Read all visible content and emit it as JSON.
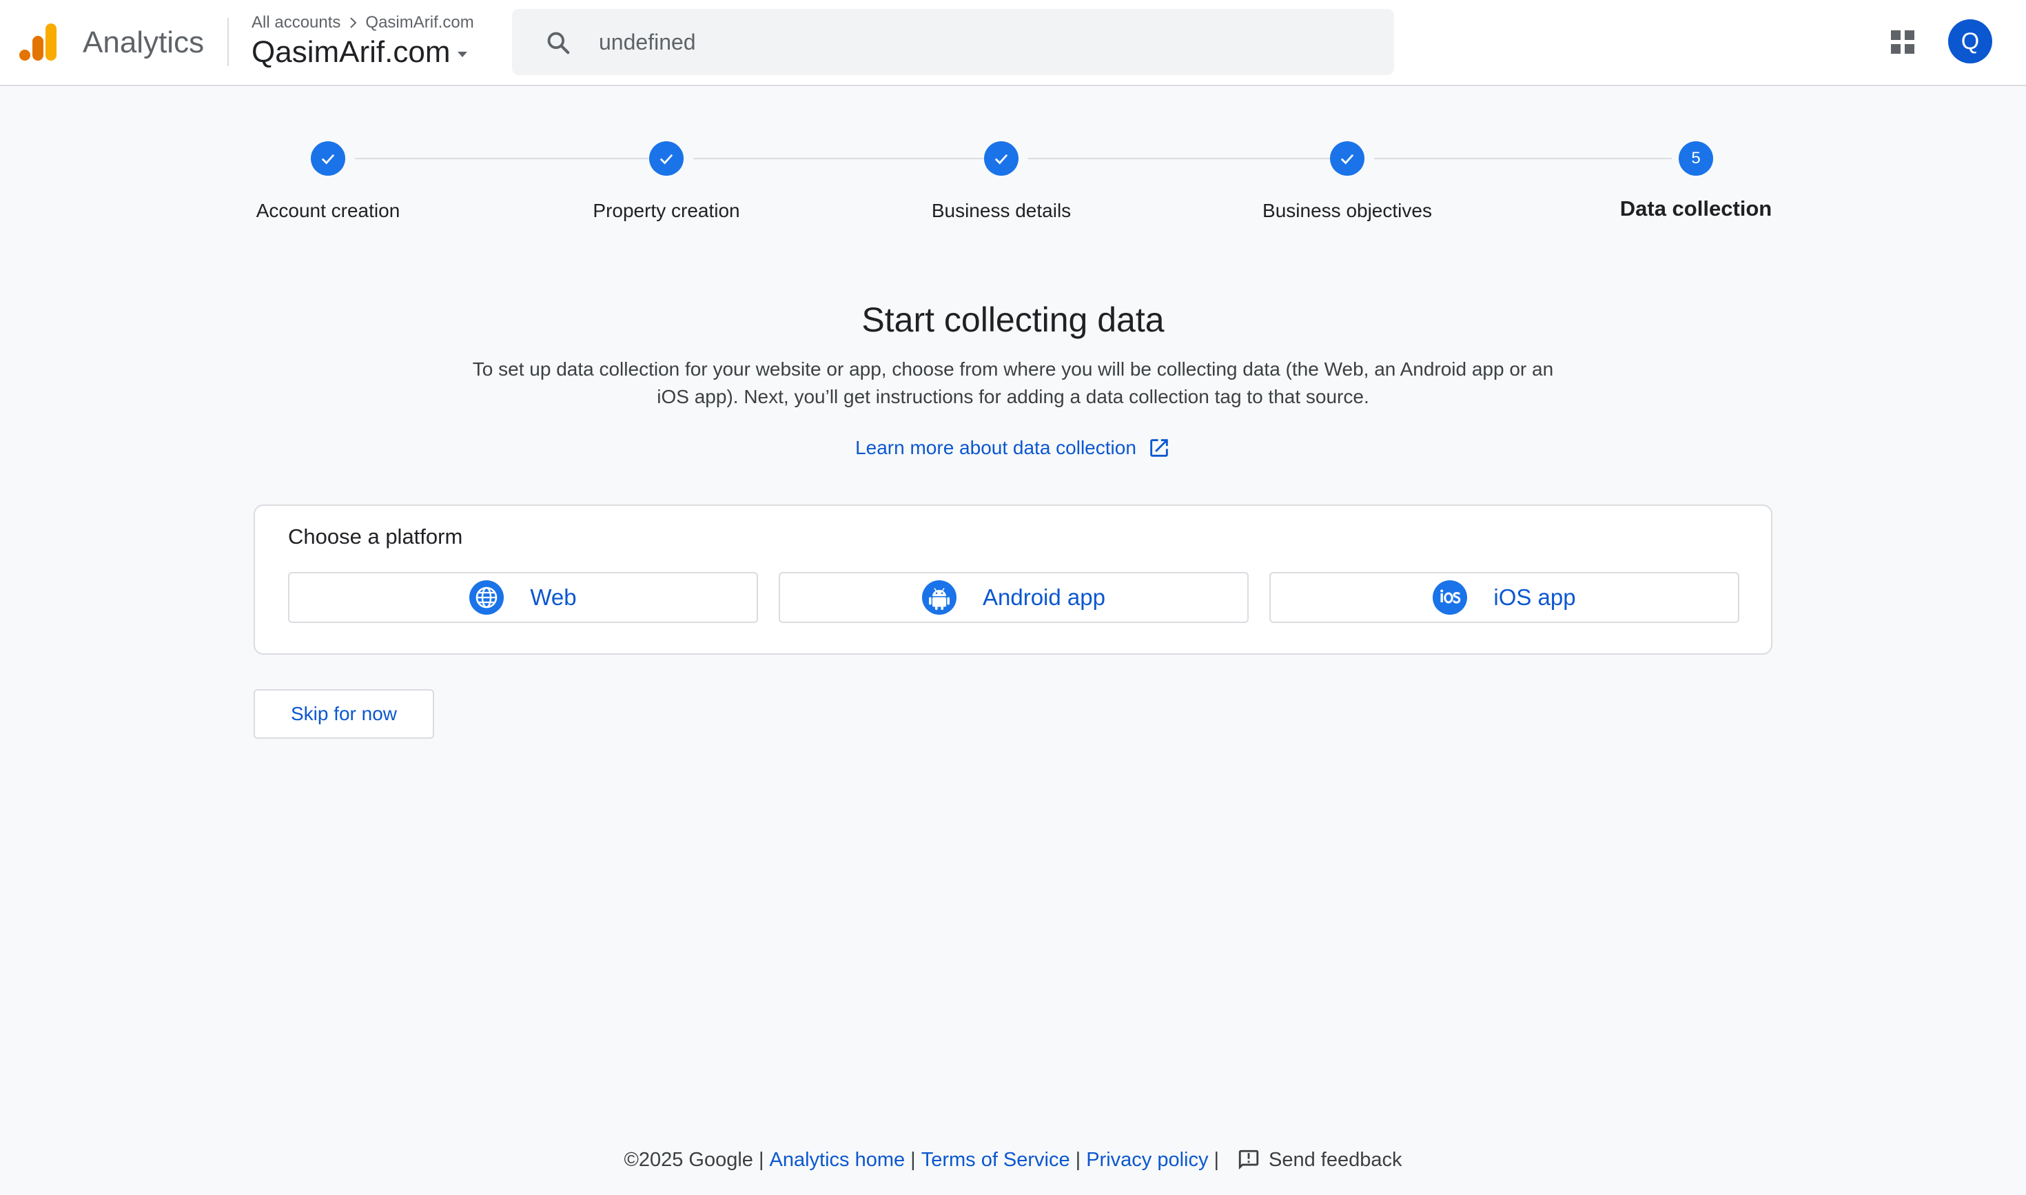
{
  "app": {
    "product_name": "Analytics",
    "brand_colors": {
      "logo_dark": "#e37400",
      "logo_light": "#f9ab00",
      "primary": "#1a73e8",
      "link": "#0b57d0"
    }
  },
  "header": {
    "breadcrumb": {
      "root": "All accounts",
      "current": "QasimArif.com"
    },
    "account_name": "QasimArif.com",
    "search": {
      "value": "undefined",
      "icon": "search-icon"
    },
    "apps_icon": "apps-grid-icon",
    "avatar_initial": "Q"
  },
  "stepper": {
    "steps": [
      {
        "label": "Account creation",
        "state": "completed",
        "icon": "check-icon"
      },
      {
        "label": "Property creation",
        "state": "completed",
        "icon": "check-icon"
      },
      {
        "label": "Business details",
        "state": "completed",
        "icon": "check-icon"
      },
      {
        "label": "Business objectives",
        "state": "completed",
        "icon": "check-icon"
      },
      {
        "label": "Data collection",
        "state": "active",
        "number": "5"
      }
    ]
  },
  "main": {
    "title": "Start collecting data",
    "description": "To set up data collection for your website or app, choose from where you will be collecting data (the Web, an Android app or an iOS app). Next, you’ll get instructions for adding a data collection tag to that source.",
    "learn_more": {
      "label": "Learn more about data collection",
      "icon": "open-in-new-icon"
    },
    "platform_card": {
      "title": "Choose a platform",
      "options": [
        {
          "label": "Web",
          "icon": "globe-icon"
        },
        {
          "label": "Android app",
          "icon": "android-icon"
        },
        {
          "label": "iOS app",
          "icon": "ios-icon"
        }
      ]
    },
    "skip_label": "Skip for now"
  },
  "footer": {
    "copyright": "©2025 Google",
    "separator": "|",
    "links": {
      "analytics_home": "Analytics home",
      "terms": "Terms of Service",
      "privacy": "Privacy policy"
    },
    "feedback": {
      "label": "Send feedback",
      "icon": "feedback-icon"
    }
  }
}
